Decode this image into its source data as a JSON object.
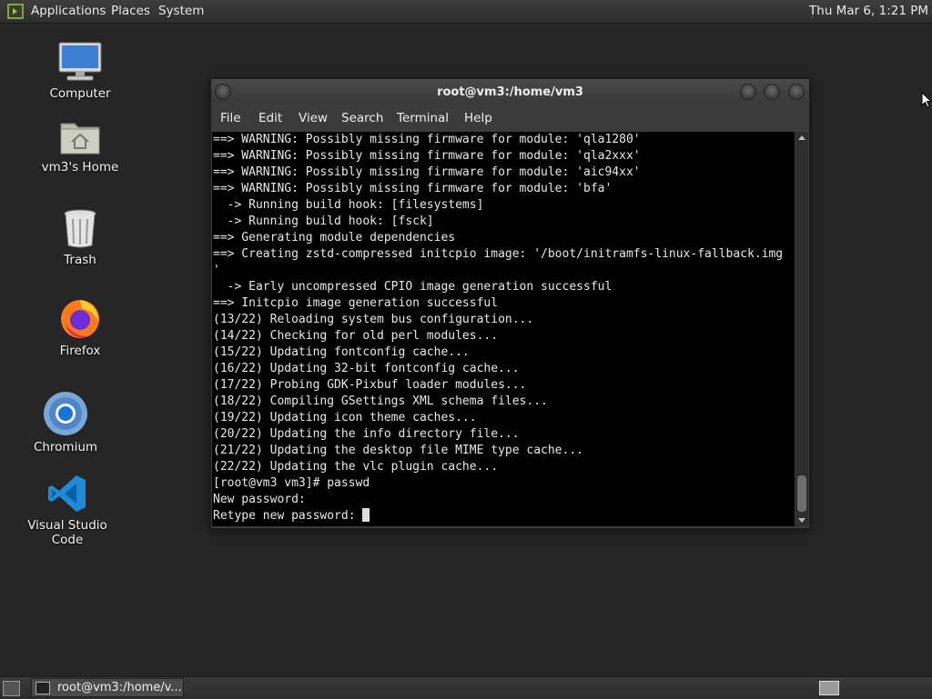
{
  "top_panel": {
    "menus": [
      "Applications",
      "Places",
      "System"
    ],
    "clock": "Thu Mar  6,  1:21 PM"
  },
  "desktop_icons": [
    {
      "label": "Computer",
      "icon": "computer-icon"
    },
    {
      "label": "vm3's Home",
      "icon": "home-folder-icon"
    },
    {
      "label": "Trash",
      "icon": "trash-icon"
    },
    {
      "label": "Firefox",
      "icon": "firefox-icon"
    },
    {
      "label": "Chromium",
      "icon": "chromium-icon"
    },
    {
      "label": "Visual Studio Code",
      "icon": "vscode-icon"
    }
  ],
  "terminal": {
    "title": "root@vm3:/home/vm3",
    "menus": [
      "File",
      "Edit",
      "View",
      "Search",
      "Terminal",
      "Help"
    ],
    "lines": [
      "==> WARNING: Possibly missing firmware for module: 'qla1280'",
      "==> WARNING: Possibly missing firmware for module: 'qla2xxx'",
      "==> WARNING: Possibly missing firmware for module: 'aic94xx'",
      "==> WARNING: Possibly missing firmware for module: 'bfa'",
      "  -> Running build hook: [filesystems]",
      "  -> Running build hook: [fsck]",
      "==> Generating module dependencies",
      "==> Creating zstd-compressed initcpio image: '/boot/initramfs-linux-fallback.img",
      "'",
      "  -> Early uncompressed CPIO image generation successful",
      "==> Initcpio image generation successful",
      "(13/22) Reloading system bus configuration...",
      "(14/22) Checking for old perl modules...",
      "(15/22) Updating fontconfig cache...",
      "(16/22) Updating 32-bit fontconfig cache...",
      "(17/22) Probing GDK-Pixbuf loader modules...",
      "(18/22) Compiling GSettings XML schema files...",
      "(19/22) Updating icon theme caches...",
      "(20/22) Updating the info directory file...",
      "(21/22) Updating the desktop file MIME type cache...",
      "(22/22) Updating the vlc plugin cache...",
      "[root@vm3 vm3]# passwd",
      "New password: "
    ],
    "prompt_line": "Retype new password: "
  },
  "bottom_panel": {
    "task_label": "root@vm3:/home/v..."
  },
  "colors": {
    "desktop_bg": "#262626",
    "terminal_bg": "#000000",
    "terminal_fg": "#e8e8e8",
    "panel_bg": "#333333"
  }
}
